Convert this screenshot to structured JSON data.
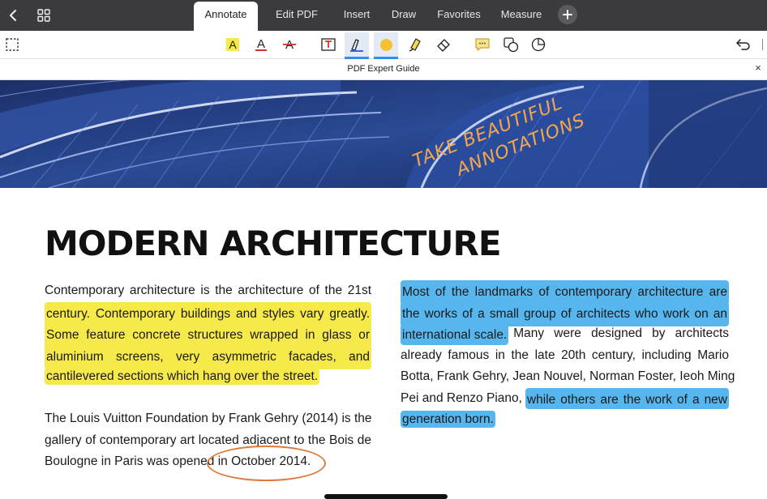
{
  "tabs": [
    {
      "label": "Annotate",
      "active": true
    },
    {
      "label": "Edit PDF",
      "active": false
    },
    {
      "label": "Insert",
      "active": false
    },
    {
      "label": "Draw",
      "active": false
    },
    {
      "label": "Favorites",
      "active": false
    },
    {
      "label": "Measure",
      "active": false
    }
  ],
  "toolbar": {
    "tools": [
      "select-area-icon",
      "highlight-icon",
      "underline-icon",
      "strikethrough-icon",
      "text-box-icon",
      "pen-icon",
      "color-swatch-icon",
      "highlighter-marker-icon",
      "eraser-icon",
      "comment-icon",
      "shapes-icon",
      "stamp-icon",
      "undo-icon"
    ],
    "selected_tool": "pen-icon",
    "pen_color": "#f5c12f"
  },
  "document": {
    "title": "PDF Expert Guide",
    "close_label": "×"
  },
  "banner": {
    "line1": "TAKE BEAUTIFUL",
    "line2": "ANNOTATIONS"
  },
  "content": {
    "heading": "MODERN ARCHITECTURE",
    "left_para1": [
      "Contemporary architecture is the architecture of the 21st",
      "century. Contemporary buildings and styles vary greatly.",
      "Some feature concrete structures wrapped in glass or",
      "aluminium screens, very asymmetric facades, and",
      "cantilevered sections which hang over the street."
    ],
    "left_para2": [
      "The Louis Vuitton Foundation by Frank Gehry (2014) is the",
      "gallery of contemporary art located adjacent to the Bois de",
      "Boulogne in Paris was opened in October 2014."
    ],
    "right_para": {
      "l1": "Most of the landmarks of contemporary architecture are",
      "l2": "the works of a small group of architects who work on an",
      "l3a": "international scale.",
      "l3b": "Many were designed by architects",
      "l4": "already famous in the late 20th century, including Mario",
      "l5": "Botta, Frank Gehry, Jean Nouvel, Norman Foster, Ieoh Ming",
      "l6a": "Pei and Renzo Piano,",
      "l6b": "while others are the work of a new",
      "l7": "generation born."
    }
  },
  "colors": {
    "highlight_yellow": "#f6e94a",
    "highlight_blue": "#58b6ee",
    "circle_annotation": "#e07a3a",
    "accent": "#2f8ff0"
  }
}
